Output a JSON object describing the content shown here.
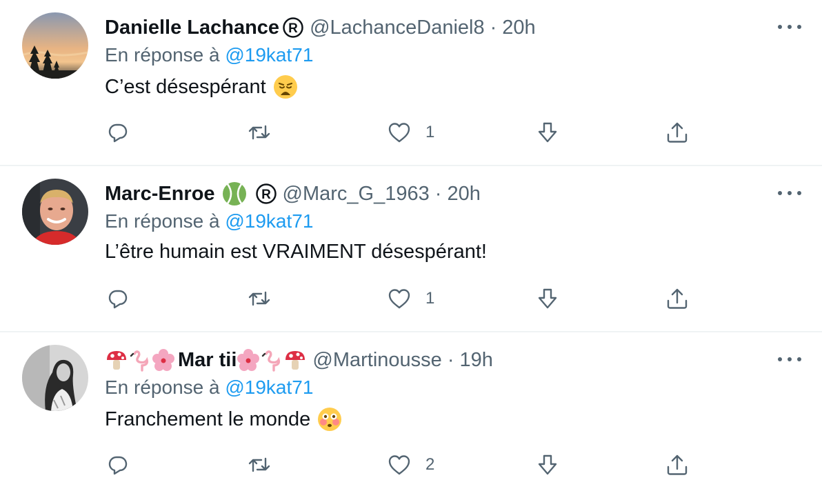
{
  "tweets": [
    {
      "name": "Danielle Lachance",
      "handle": "@LachanceDaniel8",
      "separator": "·",
      "time": "20h",
      "replying_prefix": "En réponse à ",
      "replying_to": "@19kat71",
      "text": "C’est désespérant",
      "emoji": "weary-face-emoji",
      "likes": "1"
    },
    {
      "name": "Marc-Enroe",
      "handle": "@Marc_G_1963",
      "separator": "·",
      "time": "20h",
      "replying_prefix": "En réponse à ",
      "replying_to": "@19kat71",
      "text": "L’être humain est VRAIMENT désespérant!",
      "likes": "1"
    },
    {
      "name": "Mar tii",
      "handle": "@Martinousse",
      "separator": "·",
      "time": "19h",
      "replying_prefix": "En réponse à ",
      "replying_to": "@19kat71",
      "text": "Franchement le monde",
      "emoji": "flushed-face-emoji",
      "likes": "2"
    }
  ],
  "colors": {
    "secondary_text": "#536471",
    "mention": "#1d9bf0",
    "primary_text": "#0f1419",
    "divider": "#eff3f4"
  }
}
